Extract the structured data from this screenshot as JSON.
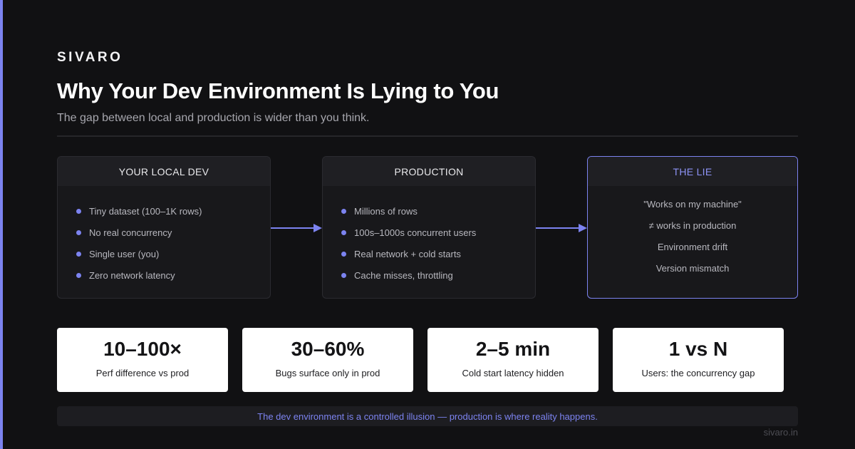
{
  "brand": "SIVARO",
  "title": "Why Your Dev Environment Is Lying to You",
  "subtitle": "The gap between local and production is wider than you think.",
  "colors": {
    "background": "#111113",
    "accent": "#7c83f0",
    "panel": "#18181b",
    "stat_card": "#ffffff"
  },
  "panels": [
    {
      "heading": "YOUR LOCAL DEV",
      "items": [
        "Tiny dataset (100–1K rows)",
        "No real concurrency",
        "Single user (you)",
        "Zero network latency"
      ]
    },
    {
      "heading": "PRODUCTION",
      "items": [
        "Millions of rows",
        "100s–1000s concurrent users",
        "Real network + cold starts",
        "Cache misses, throttling"
      ]
    },
    {
      "heading": "THE LIE",
      "items": [
        "\"Works on my machine\"",
        "≠ works in production",
        "Environment drift",
        "Version mismatch"
      ]
    }
  ],
  "arrows": [
    {
      "from": "YOUR LOCAL DEV",
      "to": "PRODUCTION",
      "icon": "arrow-right-icon"
    },
    {
      "from": "PRODUCTION",
      "to": "THE LIE",
      "icon": "arrow-right-icon"
    }
  ],
  "stats": [
    {
      "value": "10–100×",
      "label": "Perf difference vs prod"
    },
    {
      "value": "30–60%",
      "label": "Bugs surface only in prod"
    },
    {
      "value": "2–5 min",
      "label": "Cold start latency hidden"
    },
    {
      "value": "1 vs N",
      "label": "Users: the concurrency gap"
    }
  ],
  "footer": "The dev environment is a controlled illusion — production is where reality happens.",
  "site": "sivaro.in"
}
